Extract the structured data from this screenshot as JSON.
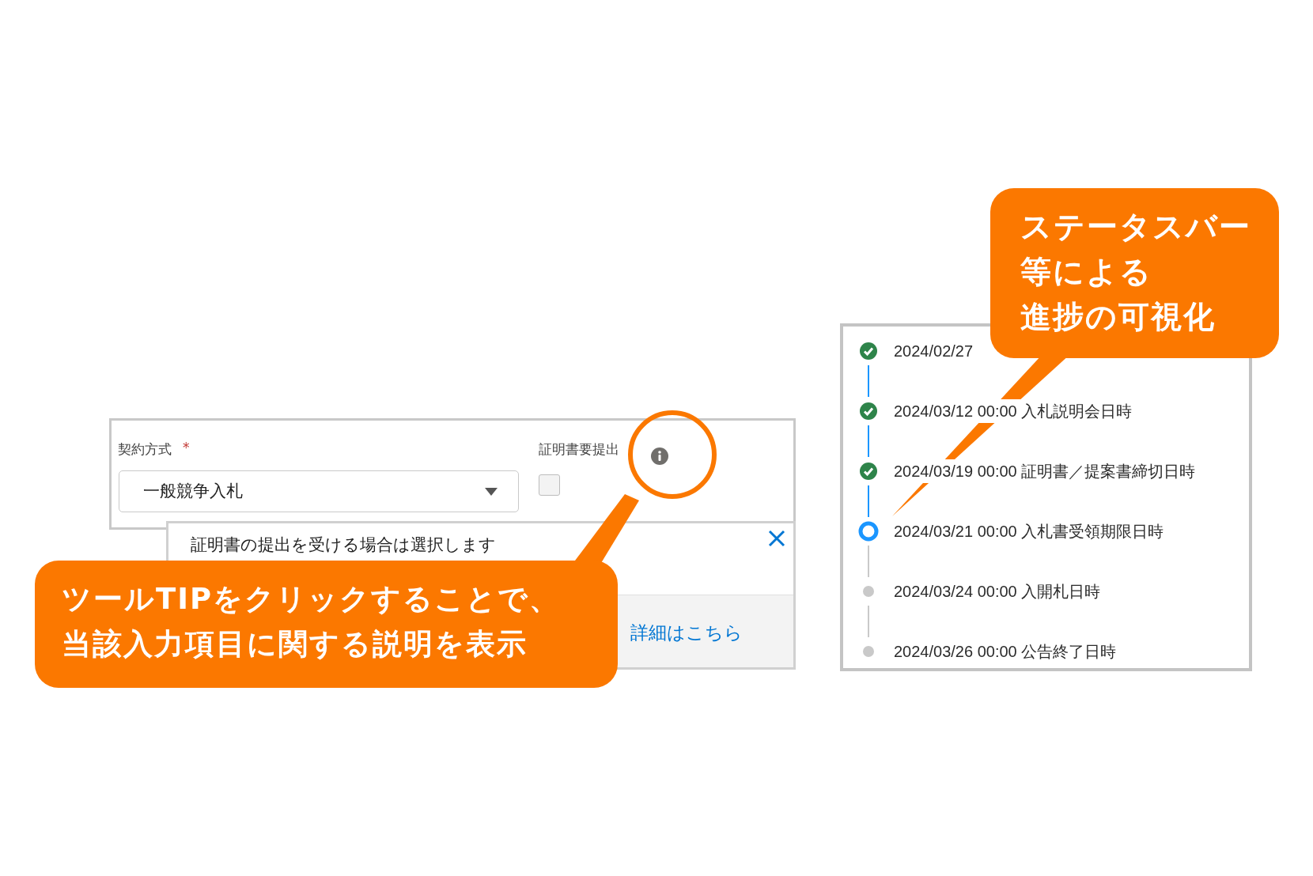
{
  "form": {
    "contract_label": "契約方式",
    "required_mark": "*",
    "contract_value": "一般競争入札",
    "cert_label": "証明書要提出",
    "cert_checked": false
  },
  "tooltip": {
    "text": "証明書の提出を受ける場合は選択します",
    "link": "詳細はこちら"
  },
  "timeline": [
    {
      "text": "2024/02/27",
      "done": true,
      "current": false
    },
    {
      "text": "2024/03/12 00:00 入札説明会日時",
      "done": true,
      "current": false
    },
    {
      "text": "2024/03/19 00:00 証明書／提案書締切日時",
      "done": true,
      "current": false
    },
    {
      "text": "2024/03/21 00:00 入札書受領期限日時",
      "done": false,
      "current": true
    },
    {
      "text": "2024/03/24 00:00 入開札日時",
      "done": false,
      "current": false
    },
    {
      "text": "2024/03/26 00:00 公告終了日時",
      "done": false,
      "current": false
    }
  ],
  "callouts": [
    {
      "lines": [
        "ツールTIPをクリックすることで、",
        "当該入力項目に関する説明を表示"
      ]
    },
    {
      "lines": [
        "ステータスバー",
        "等による",
        "進捗の可視化"
      ]
    }
  ]
}
